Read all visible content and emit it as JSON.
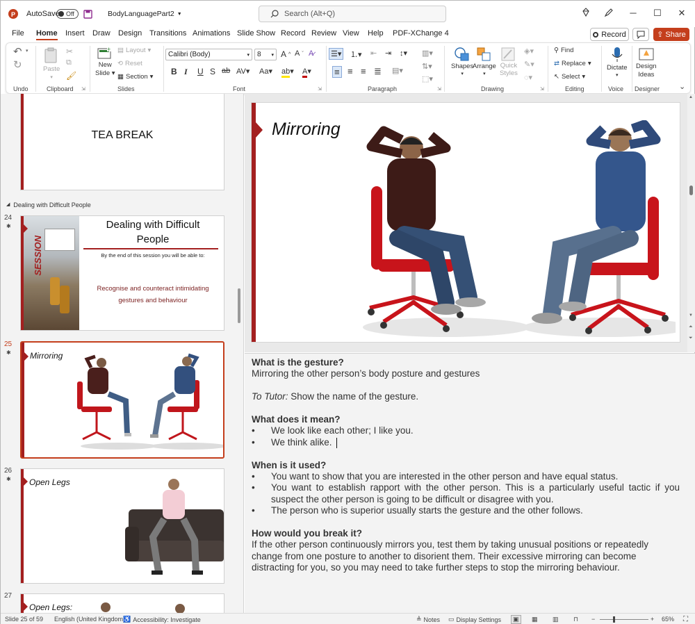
{
  "titlebar": {
    "autosave_label": "AutoSave",
    "autosave_state": "Off",
    "filename": "BodyLanguagePart2",
    "search_placeholder": "Search (Alt+Q)"
  },
  "tabs": [
    "File",
    "Home",
    "Insert",
    "Draw",
    "Design",
    "Transitions",
    "Animations",
    "Slide Show",
    "Record",
    "Review",
    "View",
    "Help",
    "PDF-XChange 4"
  ],
  "actions": {
    "record": "Record",
    "share": "Share"
  },
  "ribbon": {
    "undo_group": "Undo",
    "clipboard": {
      "paste": "Paste",
      "label": "Clipboard"
    },
    "slides": {
      "new_slide_1": "New",
      "new_slide_2": "Slide",
      "layout": "Layout",
      "reset": "Reset",
      "section": "Section",
      "label": "Slides"
    },
    "font": {
      "family": "Calibri (Body)",
      "size": "8",
      "label": "Font"
    },
    "paragraph": {
      "label": "Paragraph"
    },
    "drawing": {
      "shapes": "Shapes",
      "arrange": "Arrange",
      "quick_styles_1": "Quick",
      "quick_styles_2": "Styles",
      "label": "Drawing"
    },
    "editing": {
      "find": "Find",
      "replace": "Replace",
      "select": "Select",
      "label": "Editing"
    },
    "voice": {
      "dictate": "Dictate",
      "label": "Voice"
    },
    "designer": {
      "ideas_1": "Design",
      "ideas_2": "Ideas",
      "label": "Designer"
    }
  },
  "slides_panel": {
    "tea_break": "TEA BREAK",
    "section_name": "Dealing with Difficult People",
    "slide24": {
      "num": "24",
      "title_1": "Dealing with Difficult",
      "title_2": "People",
      "side": "SESSION",
      "intro": "By the end of this session you will be able to:",
      "objective_1": "Recognise and counteract intimidating",
      "objective_2": "gestures and behaviour"
    },
    "slide25": {
      "num": "25",
      "title": "Mirroring"
    },
    "slide26": {
      "num": "26",
      "title": "Open Legs"
    },
    "slide27": {
      "num": "27",
      "title": "Open Legs:"
    }
  },
  "main_slide": {
    "title": "Mirroring"
  },
  "notes": {
    "h1": "What is the gesture?",
    "p1": "Mirroring the other person’s body posture and gestures",
    "tutor_label": "To Tutor:",
    "tutor_text": " Show the name of the gesture.",
    "h2": "What does it mean?",
    "b1": [
      "We look like each other; I like you.",
      "We think alike."
    ],
    "h3": "When is it used?",
    "b2": [
      "You want to show that you are interested in the other person and have equal status.",
      "You want to establish rapport with the other person. This is a particularly useful tactic if you suspect the other person is going to be difficult or disagree with you.",
      "The person who is superior usually starts the gesture and the other follows."
    ],
    "h4": "How would you break it?",
    "p4": "If the other person continuously mirrors you, test them by taking unusual positions or repeatedly change from one posture to another to disorient them. Their excessive mirroring can become distracting for you, so you may need to take further steps to stop the mirroring behaviour."
  },
  "statusbar": {
    "slide": "Slide 25 of 59",
    "language": "English (United Kingdom)",
    "accessibility": "Accessibility: Investigate",
    "notes": "Notes",
    "display": "Display Settings",
    "zoom": "65%"
  },
  "colors": {
    "accent": "#c43e1c",
    "slide_red": "#a31f1f"
  }
}
